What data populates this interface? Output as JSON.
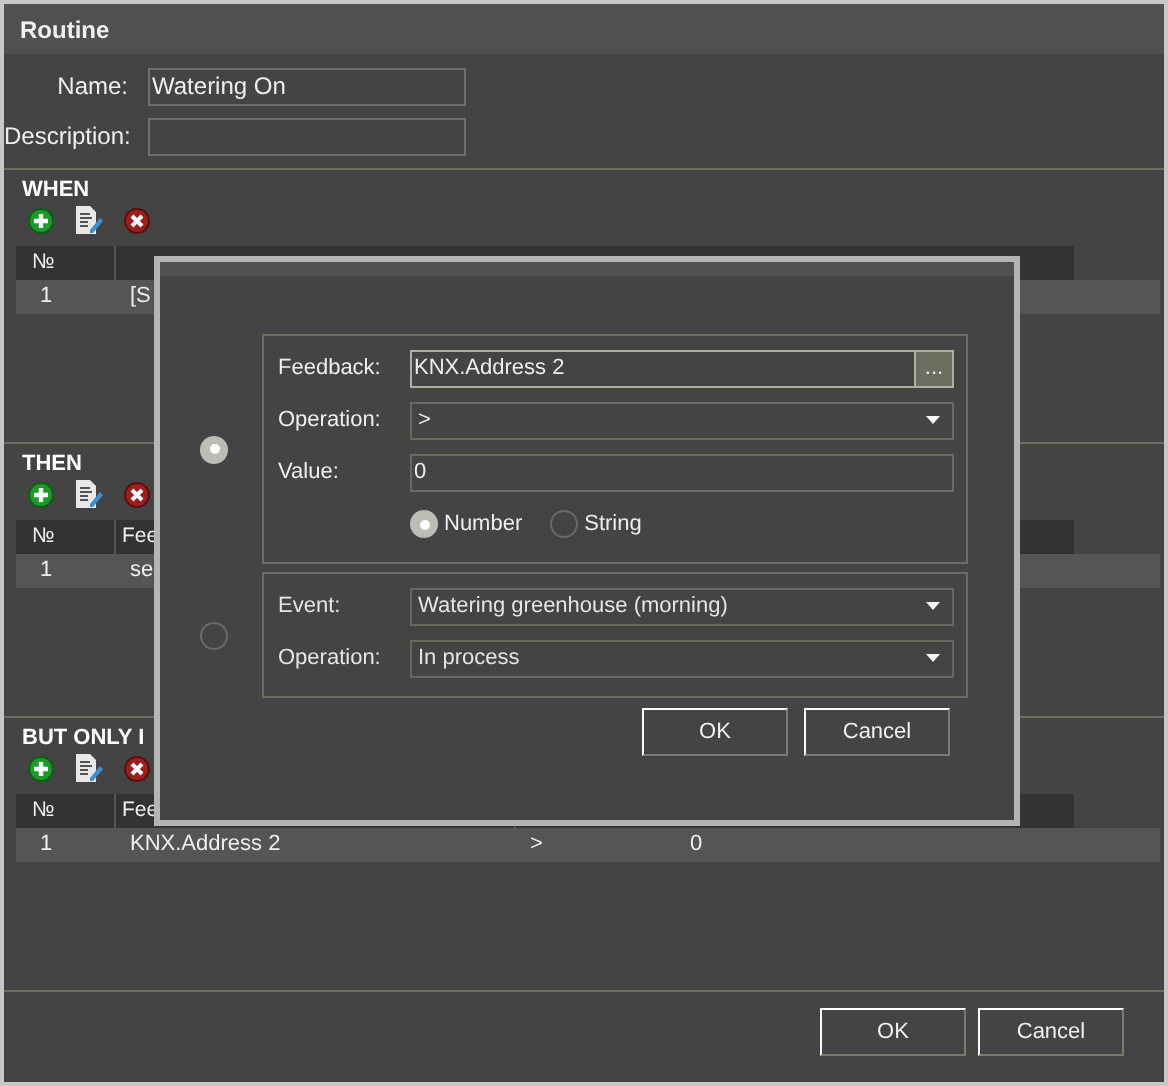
{
  "window": {
    "title": "Routine"
  },
  "name_field": {
    "label": "Name:",
    "value": "Watering On"
  },
  "description_field": {
    "label": "Description:"
  },
  "sections": [
    {
      "title": "WHEN",
      "columns": [
        "№"
      ],
      "rows": [
        [
          "1",
          "[S"
        ]
      ]
    },
    {
      "title": "THEN",
      "columns": [
        "№",
        "Fee"
      ],
      "rows": [
        [
          "1",
          "se"
        ]
      ]
    },
    {
      "title": "BUT ONLY I",
      "columns": [
        "№",
        "Fee"
      ],
      "rows": [
        [
          "1",
          "KNX.Address 2",
          ">",
          "0"
        ]
      ]
    }
  ],
  "buttons": [
    "OK",
    "Cancel"
  ],
  "dialog": {
    "options": [
      {
        "selected": true,
        "fields": [
          {
            "kind": "browse",
            "label": "Feedback:",
            "value": "KNX.Address 2",
            "button": "..."
          },
          {
            "kind": "dropdown",
            "label": "Operation:",
            "value": ">"
          },
          {
            "kind": "text",
            "label": "Value:",
            "value": "0"
          },
          {
            "kind": "radios",
            "choices": [
              {
                "label": "Number",
                "selected": true
              },
              {
                "label": "String",
                "selected": false
              }
            ]
          }
        ]
      },
      {
        "selected": false,
        "fields": [
          {
            "kind": "dropdown",
            "label": "Event:",
            "value": "Watering greenhouse (morning)"
          },
          {
            "kind": "dropdown",
            "label": "Operation:",
            "value": "In process"
          }
        ]
      }
    ],
    "buttons": [
      "OK",
      "Cancel"
    ]
  }
}
